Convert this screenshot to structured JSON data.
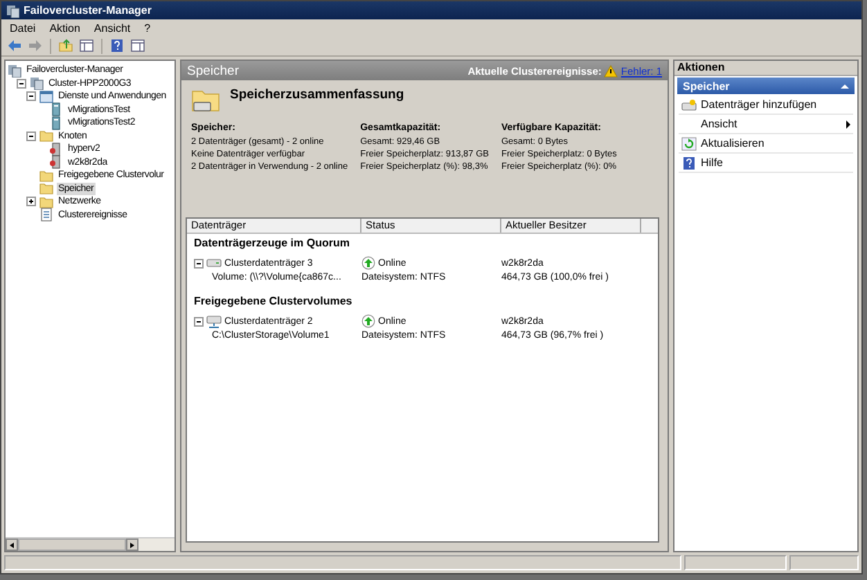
{
  "window": {
    "title": "Failovercluster-Manager"
  },
  "menu": [
    "Datei",
    "Aktion",
    "Ansicht",
    "?"
  ],
  "tree": [
    {
      "label": "Failovercluster-Manager",
      "selected": false,
      "kind": "cluster",
      "children": [
        {
          "label": "Cluster-HPP2000G3",
          "selected": false,
          "expanded": true,
          "kind": "cluster",
          "children": [
            {
              "label": "Dienste und Anwendungen",
              "selected": false,
              "expanded": true,
              "kind": "services",
              "children": [
                {
                  "label": "vMigrationsTest",
                  "selected": false,
                  "kind": "vm"
                },
                {
                  "label": "vMigrationsTest2",
                  "selected": false,
                  "kind": "vm"
                }
              ]
            },
            {
              "label": "Knoten",
              "selected": false,
              "expanded": true,
              "kind": "folder",
              "children": [
                {
                  "label": "hyperv2",
                  "selected": false,
                  "kind": "server"
                },
                {
                  "label": "w2k8r2da",
                  "selected": false,
                  "kind": "server"
                }
              ]
            },
            {
              "label": "Freigegebene Clustervolur",
              "selected": false,
              "kind": "folder"
            },
            {
              "label": "Speicher",
              "selected": true,
              "kind": "folder"
            },
            {
              "label": "Netzwerke",
              "selected": false,
              "expanded": false,
              "kind": "folder"
            },
            {
              "label": "Clusterereignisse",
              "selected": false,
              "kind": "events"
            }
          ]
        }
      ]
    }
  ],
  "center": {
    "title": "Speicher",
    "events_label": "Aktuelle Clusterereignisse:",
    "events_link": "Fehler: 1",
    "summary_title": "Speicherzusammenfassung",
    "stats": [
      {
        "heading": "Speicher:",
        "lines": [
          "2 Datenträger (gesamt) - 2 online",
          "Keine Datenträger verfügbar",
          "2 Datenträger in Verwendung - 2 online"
        ]
      },
      {
        "heading": "Gesamtkapazität:",
        "lines": [
          "Gesamt: 929,46 GB",
          "Freier Speicherplatz: 913,87 GB",
          "Freier Speicherplatz (%): 98,3%"
        ]
      },
      {
        "heading": "Verfügbare Kapazität:",
        "lines": [
          "Gesamt: 0 Bytes",
          "Freier Speicherplatz: 0 Bytes",
          "Freier Speicherplatz (%): 0%"
        ]
      }
    ],
    "table": {
      "columns": [
        "Datenträger",
        "Status",
        "Aktueller Besitzer"
      ],
      "groups": [
        {
          "title": "Datenträgerzeuge im Quorum",
          "rows": [
            {
              "expanded": true,
              "kind": "disk",
              "name": "Clusterdatenträger 3",
              "status": "Online",
              "owner": "w2k8r2da",
              "detail": "Volume: (\\\\?\\Volume{ca867c...",
              "filesystem": "Dateisystem: NTFS",
              "free": "464,73 GB (100,0% frei )"
            }
          ]
        },
        {
          "title": "Freigegebene Clustervolumes",
          "rows": [
            {
              "expanded": true,
              "kind": "shared-disk",
              "name": "Clusterdatenträger 2",
              "status": "Online",
              "owner": "w2k8r2da",
              "detail": "C:\\ClusterStorage\\Volume1",
              "filesystem": "Dateisystem: NTFS",
              "free": "464,73 GB (96,7% frei )"
            }
          ]
        }
      ]
    }
  },
  "actions": {
    "title": "Aktionen",
    "section": {
      "label": "Speicher",
      "expanded": true
    },
    "items": [
      {
        "label": "Datenträger hinzufügen",
        "kind": "add-disk"
      },
      {
        "label": "Ansicht",
        "kind": "submenu"
      },
      {
        "label": "Aktualisieren",
        "kind": "refresh"
      },
      {
        "label": "Hilfe",
        "kind": "help"
      }
    ]
  }
}
